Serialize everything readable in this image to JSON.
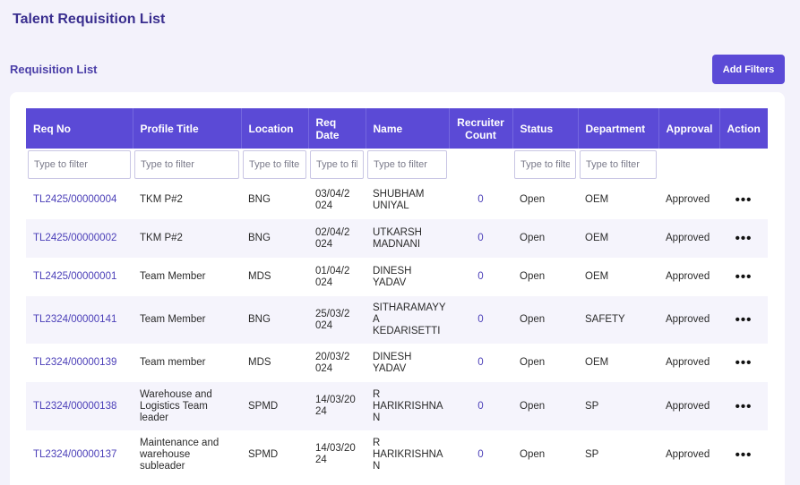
{
  "page": {
    "title": "Talent Requisition List"
  },
  "section": {
    "title": "Requisition List",
    "add_filters_label": "Add Filters"
  },
  "table": {
    "columns": [
      "Req No",
      "Profile Title",
      "Location",
      "Req\nDate",
      "Name",
      "Recruiter\nCount",
      "Status",
      "Department",
      "Approval",
      "Action"
    ],
    "filter_placeholder": "Type to filter",
    "rows": [
      {
        "req_no": "TL2425/00000004",
        "profile": "TKM P#2",
        "location": "BNG",
        "date": "03/04/2\n024",
        "name": "SHUBHAM\nUNIYAL",
        "count": "0",
        "status": "Open",
        "department": "OEM",
        "approval": "Approved",
        "action": "•••"
      },
      {
        "req_no": "TL2425/00000002",
        "profile": "TKM P#2",
        "location": "BNG",
        "date": "02/04/2\n024",
        "name": "UTKARSH\nMADNANI",
        "count": "0",
        "status": "Open",
        "department": "OEM",
        "approval": "Approved",
        "action": "•••"
      },
      {
        "req_no": "TL2425/00000001",
        "profile": "Team Member",
        "location": "MDS",
        "date": "01/04/2\n024",
        "name": "DINESH YADAV",
        "count": "0",
        "status": "Open",
        "department": "OEM",
        "approval": "Approved",
        "action": "•••"
      },
      {
        "req_no": "TL2324/00000141",
        "profile": "Team Member",
        "location": "BNG",
        "date": "25/03/2\n024",
        "name": "SITHARAMAYY\nA\nKEDARISETTI",
        "count": "0",
        "status": "Open",
        "department": "SAFETY",
        "approval": "Approved",
        "action": "•••"
      },
      {
        "req_no": "TL2324/00000139",
        "profile": "Team member",
        "location": "MDS",
        "date": "20/03/2\n024",
        "name": "DINESH YADAV",
        "count": "0",
        "status": "Open",
        "department": "OEM",
        "approval": "Approved",
        "action": "•••"
      },
      {
        "req_no": "TL2324/00000138",
        "profile": "Warehouse and\nLogistics Team\nleader",
        "location": "SPMD",
        "date": "14/03/20\n24",
        "name": "R\nHARIKRISHNA\nN",
        "count": "0",
        "status": "Open",
        "department": "SP",
        "approval": "Approved",
        "action": "•••"
      },
      {
        "req_no": "TL2324/00000137",
        "profile": "Maintenance and\nwarehouse\nsubleader",
        "location": "SPMD",
        "date": "14/03/20\n24",
        "name": "R\nHARIKRISHNA\nN",
        "count": "0",
        "status": "Open",
        "department": "SP",
        "approval": "Approved",
        "action": "•••"
      }
    ]
  },
  "colors": {
    "accent": "#5b4ad6",
    "link": "#4b3fb8",
    "background": "#f3f2fb"
  }
}
